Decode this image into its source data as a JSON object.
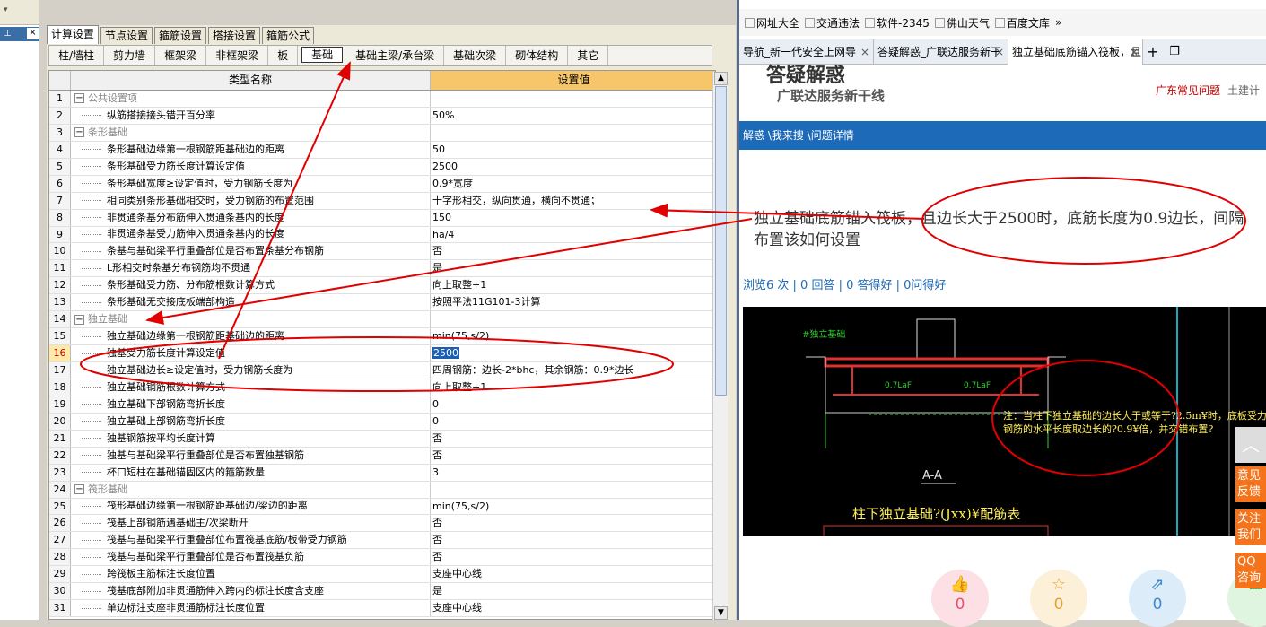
{
  "app": {
    "tabs_main": [
      "计算设置",
      "节点设置",
      "箍筋设置",
      "搭接设置",
      "箍筋公式"
    ],
    "tabs_sub": [
      "柱/墙柱",
      "剪力墙",
      "框架梁",
      "非框架梁",
      "板",
      "基础",
      "基础主梁/承台梁",
      "基础次梁",
      "砌体结构",
      "其它"
    ],
    "col_name": "类型名称",
    "col_value": "设置值",
    "rows": [
      {
        "n": "1",
        "name": "公共设置项",
        "value": "",
        "group": true
      },
      {
        "n": "2",
        "name": "纵筋搭接接头错开百分率",
        "value": "50%"
      },
      {
        "n": "3",
        "name": "条形基础",
        "value": "",
        "group": true
      },
      {
        "n": "4",
        "name": "条形基础边缘第一根钢筋距基础边的距离",
        "value": "50"
      },
      {
        "n": "5",
        "name": "条形基础受力筋长度计算设定值",
        "value": "2500"
      },
      {
        "n": "6",
        "name": "条形基础宽度≥设定值时，受力钢筋长度为",
        "value": "0.9*宽度"
      },
      {
        "n": "7",
        "name": "相同类别条形基础相交时，受力钢筋的布置范围",
        "value": "十字形相交，纵向贯通，横向不贯通；"
      },
      {
        "n": "8",
        "name": "非贯通条基分布筋伸入贯通条基内的长度",
        "value": "150"
      },
      {
        "n": "9",
        "name": "非贯通条基受力筋伸入贯通条基内的长度",
        "value": "ha/4"
      },
      {
        "n": "10",
        "name": "条基与基础梁平行重叠部位是否布置条基分布钢筋",
        "value": "否"
      },
      {
        "n": "11",
        "name": "L形相交时条基分布钢筋均不贯通",
        "value": "是"
      },
      {
        "n": "12",
        "name": "条形基础受力筋、分布筋根数计算方式",
        "value": "向上取整+1"
      },
      {
        "n": "13",
        "name": "条形基础无交接底板端部构造",
        "value": "按照平法11G101-3计算"
      },
      {
        "n": "14",
        "name": "独立基础",
        "value": "",
        "group": true
      },
      {
        "n": "15",
        "name": "独立基础边缘第一根钢筋距基础边的距离",
        "value": "min(75,s/2)"
      },
      {
        "n": "16",
        "name": "独基受力筋长度计算设定值",
        "value": "2500",
        "current": true
      },
      {
        "n": "17",
        "name": "独立基础边长≥设定值时，受力钢筋长度为",
        "value": "四周钢筋：边长-2*bhc，其余钢筋：0.9*边长"
      },
      {
        "n": "18",
        "name": "独立基础钢筋根数计算方式",
        "value": "向上取整+1"
      },
      {
        "n": "19",
        "name": "独立基础下部钢筋弯折长度",
        "value": "0"
      },
      {
        "n": "20",
        "name": "独立基础上部钢筋弯折长度",
        "value": "0"
      },
      {
        "n": "21",
        "name": "独基钢筋按平均长度计算",
        "value": "否"
      },
      {
        "n": "22",
        "name": "独基与基础梁平行重叠部位是否布置独基钢筋",
        "value": "否"
      },
      {
        "n": "23",
        "name": "杯口短柱在基础锚固区内的箍筋数量",
        "value": "3"
      },
      {
        "n": "24",
        "name": "筏形基础",
        "value": "",
        "group": true
      },
      {
        "n": "25",
        "name": "筏形基础边缘第一根钢筋距基础边/梁边的距离",
        "value": "min(75,s/2)"
      },
      {
        "n": "26",
        "name": "筏基上部钢筋遇基础主/次梁断开",
        "value": "否"
      },
      {
        "n": "27",
        "name": "筏基与基础梁平行重叠部位布置筏基底筋/板带受力钢筋",
        "value": "否"
      },
      {
        "n": "28",
        "name": "筏基与基础梁平行重叠部位是否布置筏基负筋",
        "value": "否"
      },
      {
        "n": "29",
        "name": "跨筏板主筋标注长度位置",
        "value": "支座中心线"
      },
      {
        "n": "30",
        "name": "筏基底部附加非贯通筋伸入跨内的标注长度含支座",
        "value": "是"
      },
      {
        "n": "31",
        "name": "单边标注支座非贯通筋标注长度位置",
        "value": "支座中心线"
      }
    ]
  },
  "browser": {
    "bookmarks": [
      "网址大全",
      "交通违法",
      "软件-2345",
      "佛山天气",
      "百度文库"
    ],
    "tabs": [
      "导航_新一代安全上网导",
      "答疑解惑_广联达服务新干",
      "独立基础底筋锚入筏板，且"
    ],
    "logo_big": "答疑解惑",
    "logo_sub": "广联达服务新干线",
    "top_link_1": "广东常见问题",
    "top_link_2": "土建计",
    "breadcrumb": "解惑 \\我来搜 \\问题详情",
    "question": "独立基础底筋锚入筏板，且边长大于2500时，底筋长度为0.9边长，间隔布置该如何设置",
    "stats": "浏览6 次 | 0 回答 | 0 答得好 | 0问得好",
    "cad_label_1": "0.7LaF",
    "cad_label_2": "0.7LaF",
    "cad_note": "注：当柱下独立基础的边长大于或等于?2.5m¥时，底板受力钢筋的水平长度取边长的?0.9¥倍，并交错布置?",
    "cad_section": "A-A",
    "cad_table_title": "柱下独立基础?(Jxx)¥配筋表",
    "cad_tag": "#独立基础",
    "counts": [
      "0",
      "0",
      "0"
    ],
    "side_buttons": [
      "意见反馈",
      "关注我们",
      "QQ咨询"
    ]
  },
  "colors": {
    "accent_blue": "#1c6ab8",
    "annotation_red": "#e00000",
    "header_orange": "#f7c56a"
  }
}
